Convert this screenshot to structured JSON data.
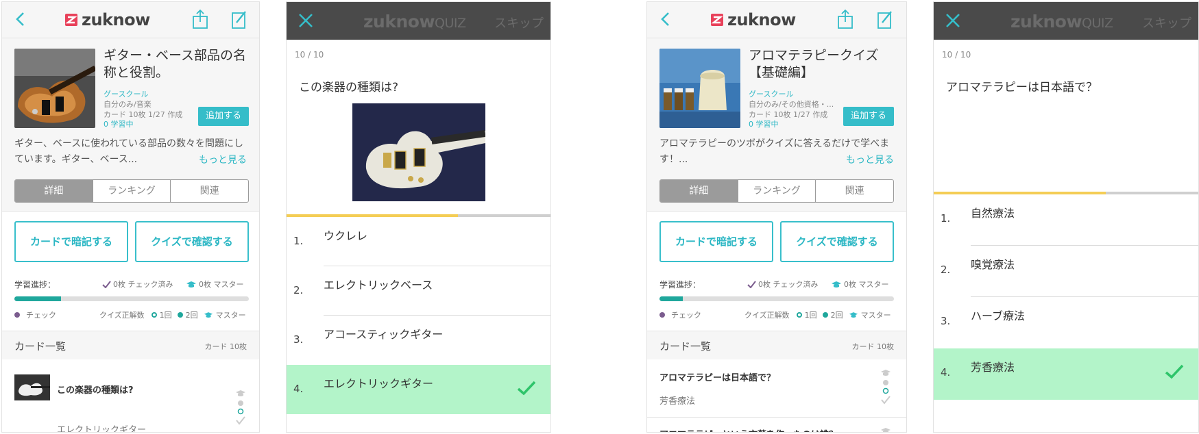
{
  "colors": {
    "accent": "#35bdc9",
    "progress": "#1fa79c",
    "correct_bg": "#b3f4c9",
    "check": "#2ec46a",
    "quiz_header": "#4a4a4a",
    "quiz_progress": "#f4cd55",
    "check_mark": "#7b5c8e"
  },
  "screen1": {
    "header": {
      "logo": "zuknow",
      "icons": [
        "back-icon",
        "share-icon",
        "edit-icon"
      ]
    },
    "deck": {
      "title": "ギター・ベース部品の名称と役割。",
      "owner": "グースクール",
      "category": "自分のみ/音楽",
      "created": "カード 10枚 1/27 作成",
      "learners": "0 学習中",
      "add_label": "追加する",
      "description": "ギター、ベースに使われている部品の数々を問題にしています。ギター、ベース...",
      "more_label": "もっと見る"
    },
    "tabs": [
      "詳細",
      "ランキング",
      "関連"
    ],
    "actions": {
      "cards_label": "カードで暗記する",
      "quiz_label": "クイズで確認する"
    },
    "progress": {
      "label": "学習進捗：",
      "checked": "0枚 チェック済み",
      "mastered": "0枚 マスター",
      "fill": 0.2,
      "legend_check": "チェック",
      "legend_quiz": "クイズ正解数",
      "legend_1": "1回",
      "legend_2": "2回",
      "legend_master": "マスター"
    },
    "card_list": {
      "title": "カード一覧",
      "count": "カード 10枚",
      "items": [
        {
          "question": "この楽器の種類は?",
          "answer": "エレクトリックギター"
        }
      ]
    }
  },
  "screen2": {
    "header": {
      "logo": "zuknow",
      "logo_suffix": "QUIZ",
      "skip": "スキップ"
    },
    "counter": "10 / 10",
    "question": "この楽器の種類は?",
    "progress_fill": 0.65,
    "choices": [
      {
        "num": "1.",
        "text": "ウクレレ",
        "correct": false
      },
      {
        "num": "2.",
        "text": "エレクトリックベース",
        "correct": false
      },
      {
        "num": "3.",
        "text": "アコースティックギター",
        "correct": false
      },
      {
        "num": "4.",
        "text": "エレクトリックギター",
        "correct": true
      }
    ]
  },
  "screen3": {
    "header": {
      "logo": "zuknow",
      "icons": [
        "back-icon",
        "share-icon",
        "edit-icon"
      ]
    },
    "deck": {
      "title": "アロマテラピークイズ【基礎編】",
      "owner": "グースクール",
      "category": "自分のみ/その他資格・...",
      "created": "カード 10枚 1/27 作成",
      "learners": "0 学習中",
      "add_label": "追加する",
      "description": "アロマテラピーのツボがクイズに答えるだけで学べます！...",
      "more_label": "もっと見る"
    },
    "tabs": [
      "詳細",
      "ランキング",
      "関連"
    ],
    "actions": {
      "cards_label": "カードで暗記する",
      "quiz_label": "クイズで確認する"
    },
    "progress": {
      "label": "学習進捗：",
      "checked": "0枚 チェック済み",
      "mastered": "0枚 マスター",
      "fill": 0.1,
      "legend_check": "チェック",
      "legend_quiz": "クイズ正解数",
      "legend_1": "1回",
      "legend_2": "2回",
      "legend_master": "マスター"
    },
    "card_list": {
      "title": "カード一覧",
      "count": "カード 10枚",
      "items": [
        {
          "question": "アロマテラピーは日本語で？",
          "answer": "芳香療法"
        },
        {
          "question": "アロマテラピーという言葉を作ったのは誰？",
          "answer": ""
        }
      ]
    }
  },
  "screen4": {
    "header": {
      "logo": "zuknow",
      "logo_suffix": "QUIZ",
      "skip": "スキップ"
    },
    "counter": "10 / 10",
    "question": "アロマテラピーは日本語で？",
    "progress_fill": 0.65,
    "choices": [
      {
        "num": "1.",
        "text": "自然療法",
        "correct": false
      },
      {
        "num": "2.",
        "text": "嗅覚療法",
        "correct": false
      },
      {
        "num": "3.",
        "text": "ハーブ療法",
        "correct": false
      },
      {
        "num": "4.",
        "text": "芳香療法",
        "correct": true
      }
    ]
  }
}
